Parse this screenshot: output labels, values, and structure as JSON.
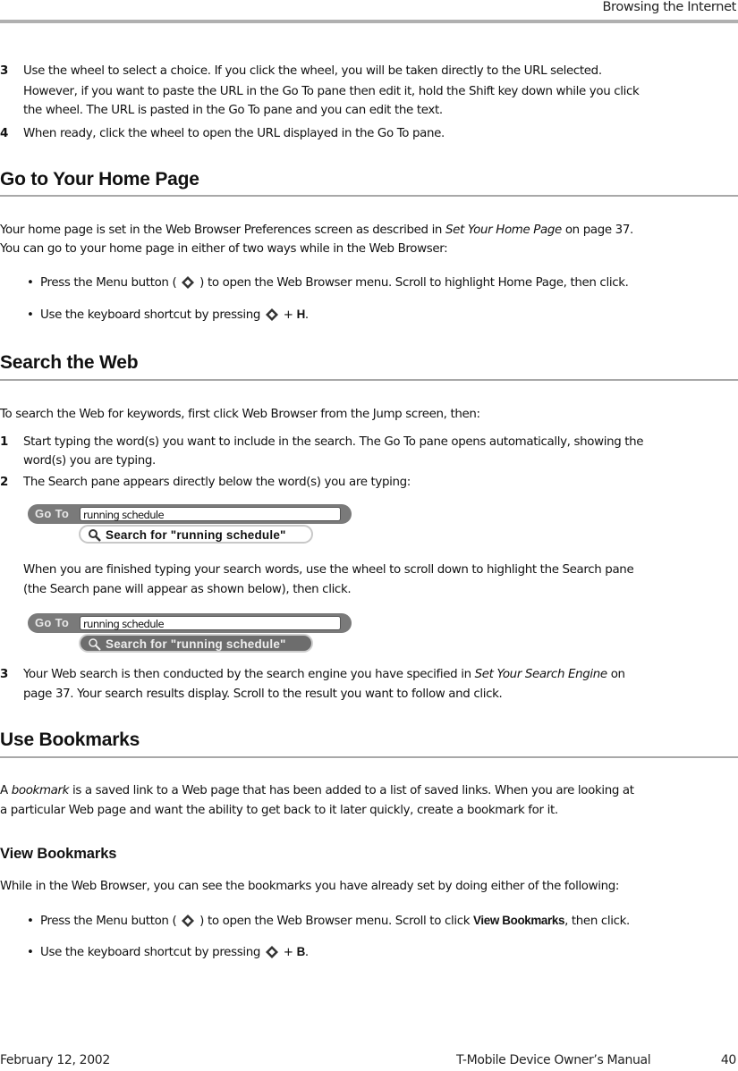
{
  "header": {
    "running_title": "Browsing the Internet"
  },
  "intro_steps": [
    {
      "number": "3",
      "lines": [
        "Use the wheel to select a choice. If you click the wheel, you will be taken directly to the URL selected.",
        "However, if you want to paste the URL in the Go To pane then edit it, hold the Shift key down while you click",
        "the wheel. The URL is pasted in the Go To pane and you can edit the text."
      ]
    },
    {
      "number": "4",
      "lines": [
        "When ready, click the wheel to open the URL displayed in the Go To pane."
      ]
    }
  ],
  "home_page": {
    "heading": "Go to Your Home Page",
    "para_line1_a": "Your home page is set in the Web Browser Preferences screen as described in ",
    "para_line1_link": "Set Your Home Page",
    "para_line1_b": " on page 37.",
    "para_line2": "You can go to your home page in either of two ways while in the Web Browser:",
    "bullets": [
      {
        "a": "Press the Menu button ( ",
        "b": " ) to open the Web Browser menu. Scroll to highlight Home Page, then click."
      },
      {
        "a": "Use the keyboard shortcut by pressing ",
        "b": " + ",
        "key": "H",
        "c": "."
      }
    ],
    "bullet_char": "•"
  },
  "search_web": {
    "heading": "Search the Web",
    "intro": "To search the Web for keywords, first click Web Browser from the Jump screen, then:",
    "step1": {
      "number": "1",
      "lines": [
        "Start typing the word(s) you want to include in the search. The Go To pane opens automatically, showing the",
        "word(s) you are typing."
      ]
    },
    "step2": {
      "number": "2",
      "lines": [
        "The Search pane appears directly below the word(s) you are typing:"
      ]
    },
    "widget1": {
      "label": "Go To",
      "value": "running schedule",
      "search_label": "Search for \"running schedule\""
    },
    "middle_lines": [
      "When you are finished typing your search words, use the wheel to scroll down to highlight the Search pane",
      "(the Search pane will appear as shown below), then click."
    ],
    "widget2": {
      "label": "Go To",
      "value": "running schedule",
      "search_label": "Search for \"running schedule\""
    },
    "step3": {
      "number": "3",
      "line1_a": "Your Web search is then conducted by the search engine you have specified in ",
      "line1_link": "Set Your Search Engine",
      "line1_b": " on",
      "line2": "page 37. Your search results display. Scroll to the result you want to follow and click."
    }
  },
  "bookmarks": {
    "heading": "Use Bookmarks",
    "para_a": "A ",
    "para_term": "bookmark",
    "para_b": " is a saved link to a Web page that has been added to a list of saved links. When you are looking at",
    "para_line2": "a particular Web page and want the ability to get back to it later quickly, create a bookmark for it.",
    "view": {
      "heading": "View Bookmarks",
      "intro": "While in the Web Browser, you can see the bookmarks you have already set by doing either of the following:",
      "bullets": [
        {
          "a": "Press the Menu button ( ",
          "b": " ) to open the Web Browser menu. Scroll to click ",
          "bold": "View Bookmarks",
          "c": ", then click."
        },
        {
          "a": "Use the keyboard shortcut by pressing ",
          "b": " + ",
          "key": "B",
          "c": "."
        }
      ]
    }
  },
  "footer": {
    "date": "February 12, 2002",
    "manual": "T-Mobile Device Owner’s Manual",
    "page": "40"
  }
}
